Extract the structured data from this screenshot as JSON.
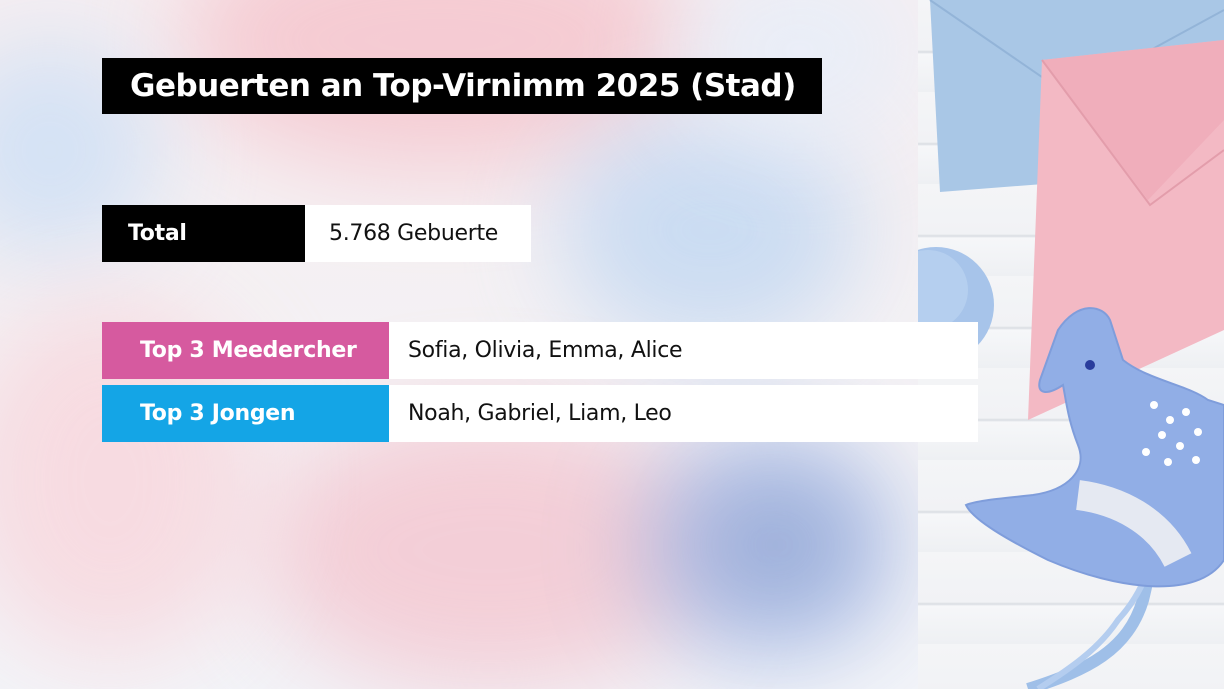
{
  "title": "Gebuerten an Top-Virnimm 2025 (Stad)",
  "total": {
    "label": "Total",
    "value": "5.768 Gebuerte"
  },
  "top_girls": {
    "label": "Top 3 Meedercher",
    "value": "Sofia, Olivia, Emma, Alice",
    "color": "#d65a9f"
  },
  "top_boys": {
    "label": "Top 3 Jongen",
    "value": "Noah, Gabriel, Liam, Leo",
    "color": "#14a5e6"
  }
}
